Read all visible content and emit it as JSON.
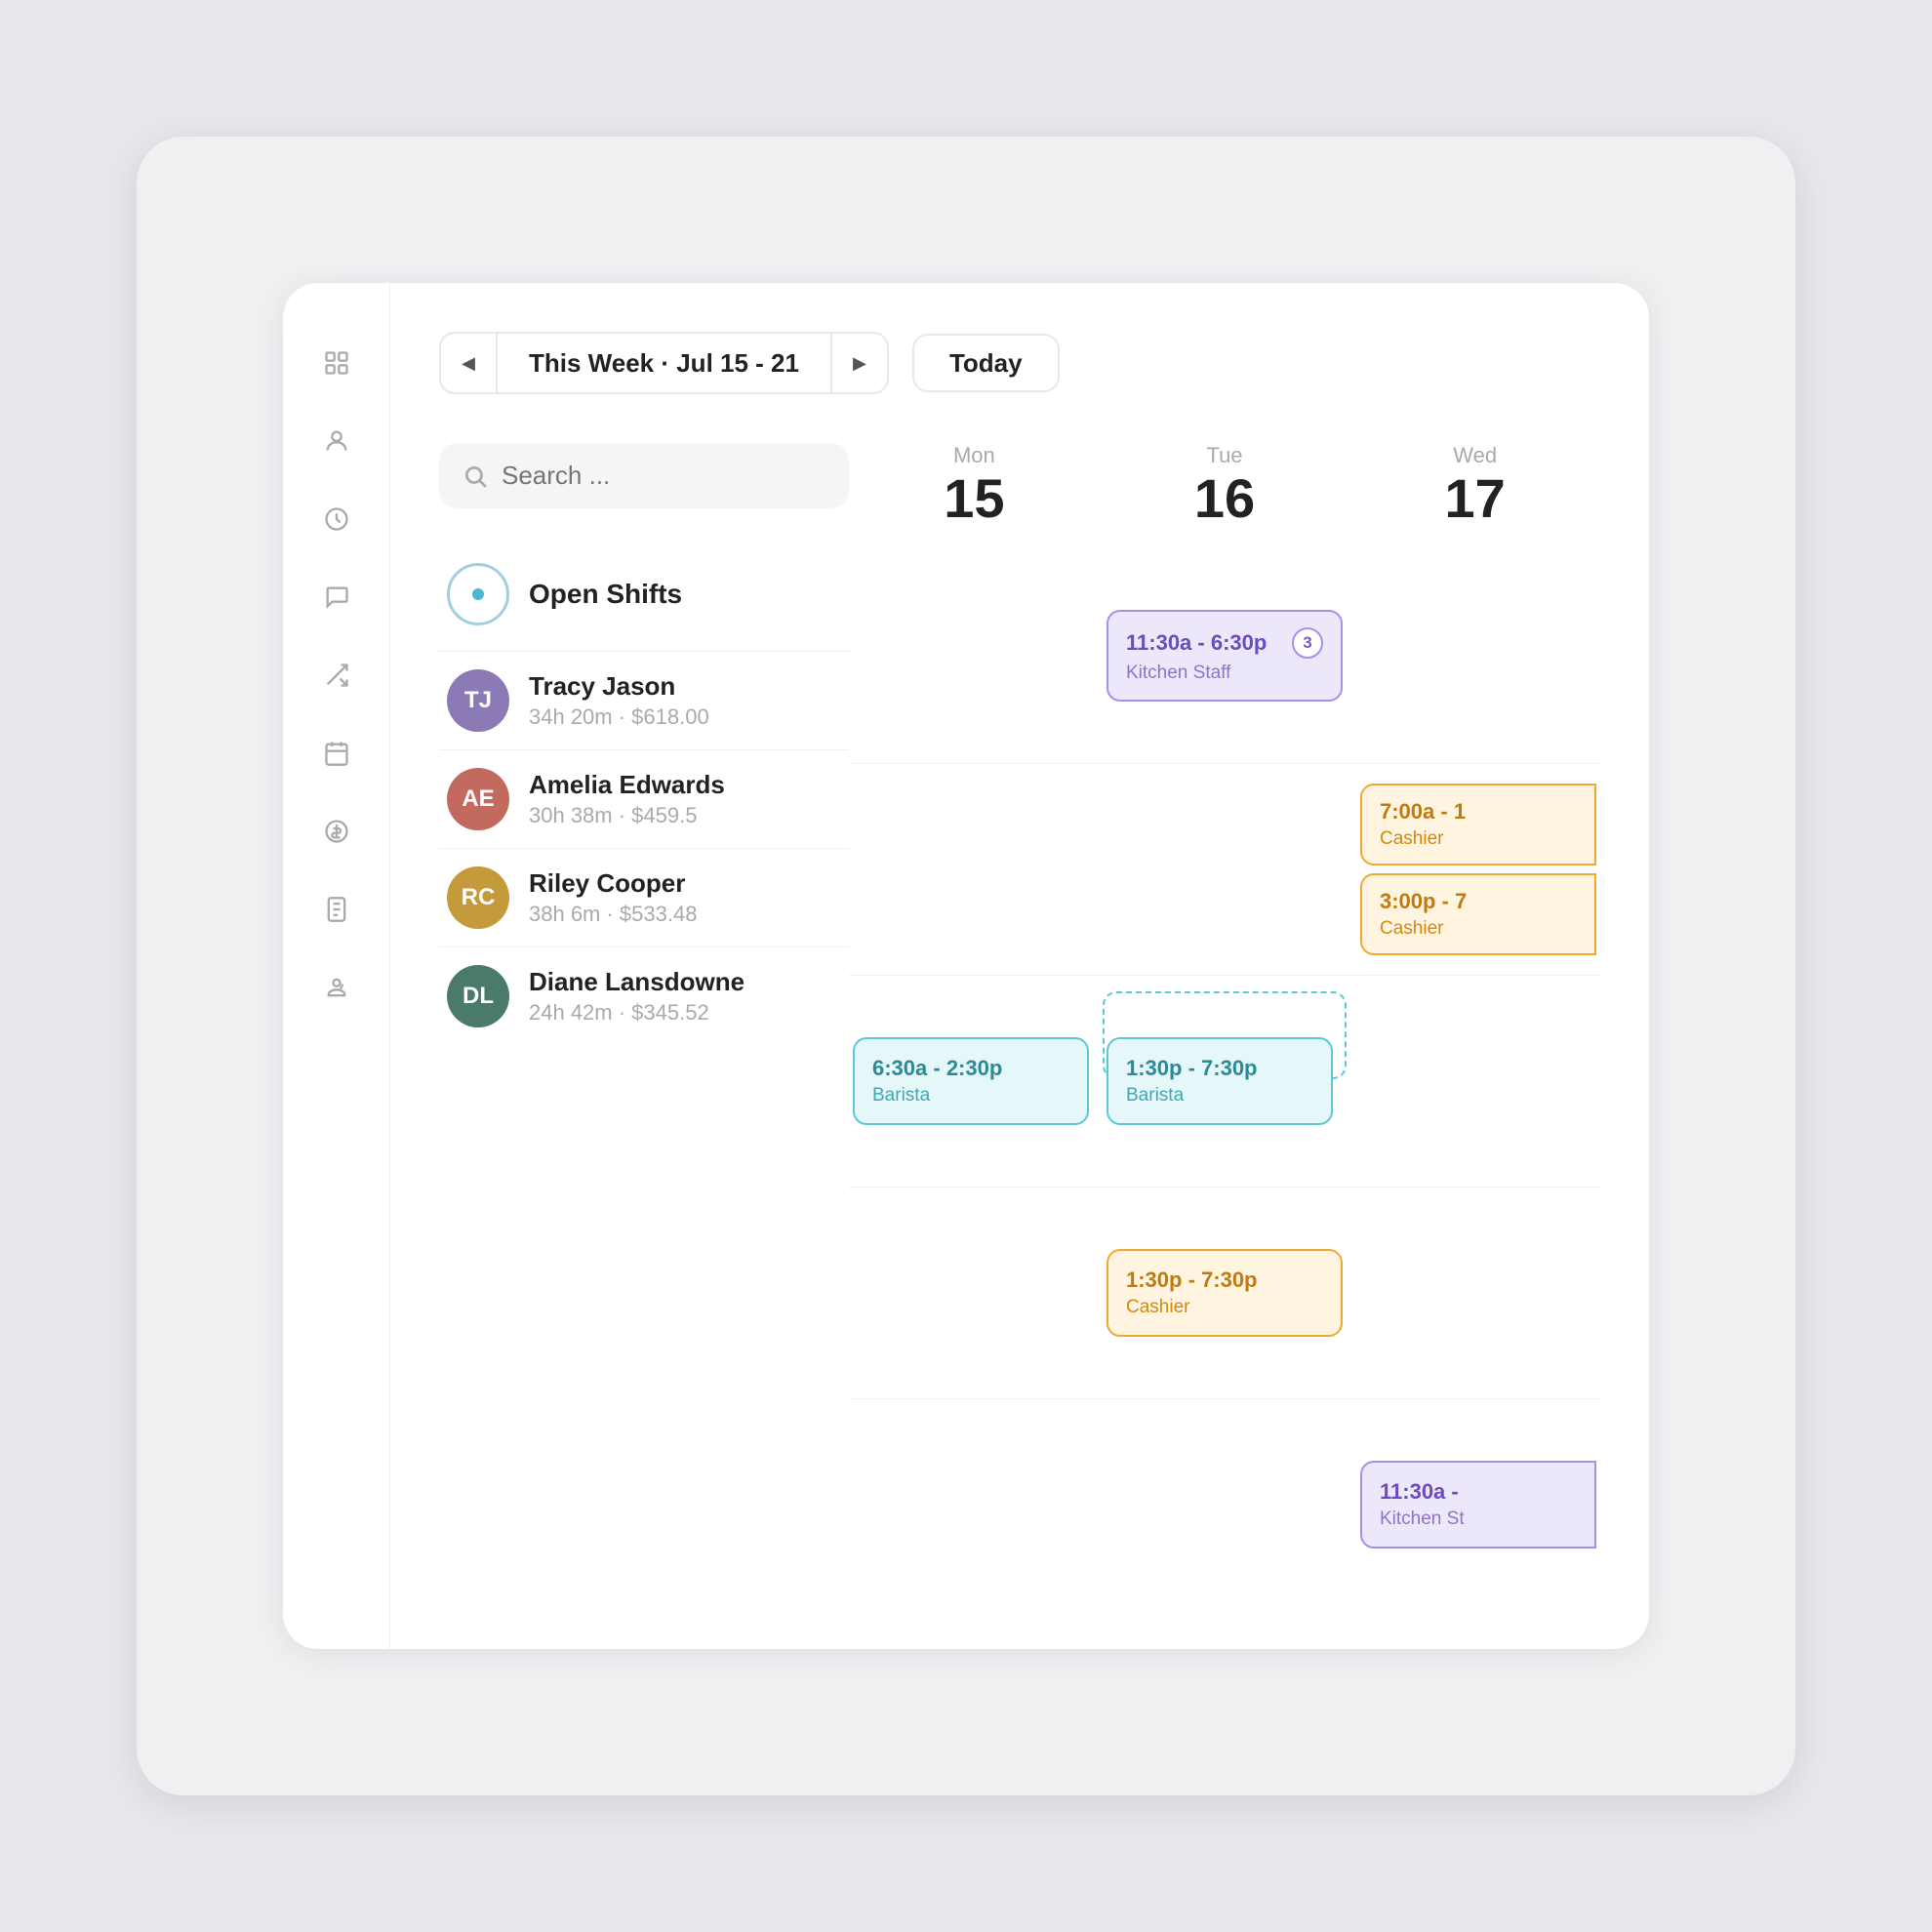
{
  "header": {
    "week_label": "This Week · Jul 15 - 21",
    "today_btn": "Today",
    "prev_icon": "◀",
    "next_icon": "▶"
  },
  "search": {
    "placeholder": "Search ..."
  },
  "open_shifts": {
    "label": "Open Shifts"
  },
  "staff": [
    {
      "name": "Tracy Jason",
      "meta": "34h 20m · $618.00",
      "avatar_color": "#8b7ab5",
      "initials": "TJ"
    },
    {
      "name": "Amelia Edwards",
      "meta": "30h 38m · $459.5",
      "avatar_color": "#c26a5e",
      "initials": "AE"
    },
    {
      "name": "Riley Cooper",
      "meta": "38h 6m · $533.48",
      "avatar_color": "#c49a3a",
      "initials": "RC"
    },
    {
      "name": "Diane Lansdowne",
      "meta": "24h 42m · $345.52",
      "avatar_color": "#4a7a6a",
      "initials": "DL"
    }
  ],
  "days": [
    {
      "name": "Mon",
      "num": "15"
    },
    {
      "name": "Tue",
      "num": "16"
    },
    {
      "name": "Wed",
      "num": "17"
    }
  ],
  "shifts": {
    "open_shifts": {
      "tue": {
        "time": "11:30a - 6:30p",
        "role": "Kitchen Staff",
        "type": "purple",
        "badge": "3"
      }
    },
    "tracy": {
      "wed_1": {
        "time": "7:00a - 1",
        "role": "Cashier",
        "type": "orange",
        "partial": true
      },
      "wed_2": {
        "time": "3:00p - 7",
        "role": "Cashier",
        "type": "orange",
        "partial": true
      }
    },
    "amelia": {
      "mon": {
        "time": "6:30a - 2:30p",
        "role": "Barista",
        "type": "teal"
      },
      "mon_dashed": true,
      "tue": {
        "time": "1:30p - 7:30p",
        "role": "Barista",
        "type": "teal"
      }
    },
    "riley": {
      "tue": {
        "time": "1:30p - 7:30p",
        "role": "Cashier",
        "type": "orange"
      }
    },
    "diane": {
      "wed": {
        "time": "11:30a -",
        "role": "Kitchen St",
        "type": "purple",
        "partial": true
      }
    }
  },
  "sidebar_icons": [
    "grid",
    "person",
    "clock",
    "chat",
    "shuffle",
    "calendar",
    "dollar",
    "receipt",
    "person-alt"
  ]
}
